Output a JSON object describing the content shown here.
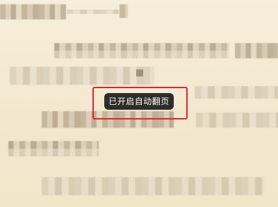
{
  "reader": {
    "toast_message": "已开启自动翻页",
    "highlight_color": "#e0232f",
    "toast_background": "#1c1c1c",
    "page_background": "#f5ecd6"
  }
}
